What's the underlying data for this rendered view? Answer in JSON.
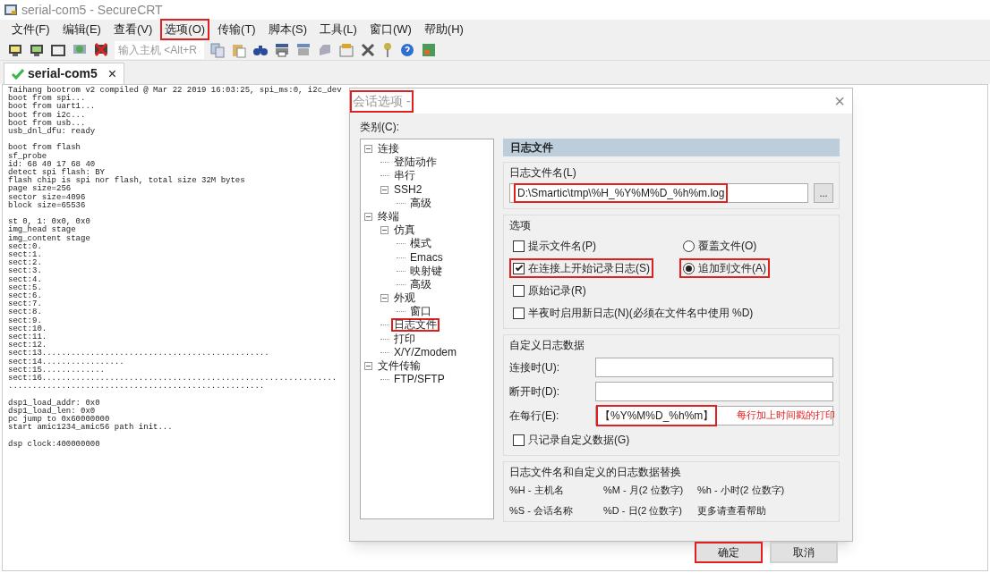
{
  "window": {
    "title": "serial-com5 - SecureCRT"
  },
  "menu": [
    {
      "label": "文件(F)",
      "highlighted": false
    },
    {
      "label": "编辑(E)",
      "highlighted": false
    },
    {
      "label": "查看(V)",
      "highlighted": false
    },
    {
      "label": "选项(O)",
      "highlighted": true
    },
    {
      "label": "传输(T)",
      "highlighted": false
    },
    {
      "label": "脚本(S)",
      "highlighted": false
    },
    {
      "label": "工具(L)",
      "highlighted": false
    },
    {
      "label": "窗口(W)",
      "highlighted": false
    },
    {
      "label": "帮助(H)",
      "highlighted": false
    }
  ],
  "toolbar": {
    "host_field": {
      "placeholder": "输入主机 <Alt+R"
    }
  },
  "tabs": [
    {
      "label": "serial-com5",
      "close": "×",
      "connected": true
    }
  ],
  "terminal": {
    "blocks": [
      [
        "Taihang bootrom v2 compiled @ Mar 22 2019 16:03:25, spi_ms:0, i2c_dev",
        "boot from spi...",
        "boot from uart1...",
        "boot from i2c...",
        "boot from usb...",
        "usb_dnl_dfu: ready"
      ],
      [
        "boot from flash",
        "sf_probe",
        "id: 68 40 17 68 40",
        "detect spi flash: BY",
        "flash chip is spi nor flash, total size 32M bytes",
        "page size=256",
        "sector size=4096",
        "block size=65536"
      ],
      [
        "st 0, 1: 0x0, 0x0",
        "img_head stage",
        "img_content stage",
        "sect:0.",
        "sect:1.",
        "sect:2.",
        "sect:3.",
        "sect:4.",
        "sect:5.",
        "sect:6.",
        "sect:7.",
        "sect:8.",
        "sect:9.",
        "sect:10.",
        "sect:11.",
        "sect:12.",
        "sect:13...............................................",
        "sect:14.................",
        "sect:15.............",
        "sect:16.............................................................",
        "....................................................."
      ],
      [
        "dsp1_load_addr: 0x0",
        "dsp1_load_len: 0x0",
        "pc jump to 0x60000000",
        "start amic1234_amic56 path init..."
      ],
      [
        "dsp clock:400000000"
      ]
    ]
  },
  "dialog": {
    "title": "会话选项 -",
    "title_highlighted": true,
    "close": "×",
    "category_label": "类别(C):",
    "tree": [
      {
        "label": "连接",
        "expanded": true,
        "highlighted": false,
        "children": [
          {
            "label": "登陆动作",
            "highlighted": false
          },
          {
            "label": "串行",
            "highlighted": false
          },
          {
            "label": "SSH2",
            "expanded": true,
            "highlighted": false,
            "children": [
              {
                "label": "高级",
                "highlighted": false
              }
            ]
          }
        ]
      },
      {
        "label": "终端",
        "expanded": true,
        "highlighted": false,
        "children": [
          {
            "label": "仿真",
            "expanded": true,
            "highlighted": false,
            "children": [
              {
                "label": "模式",
                "highlighted": false
              },
              {
                "label": "Emacs",
                "highlighted": false
              },
              {
                "label": "映射键",
                "highlighted": false
              },
              {
                "label": "高级",
                "highlighted": false
              }
            ]
          },
          {
            "label": "外观",
            "expanded": true,
            "highlighted": false,
            "children": [
              {
                "label": "窗口",
                "highlighted": false
              }
            ]
          },
          {
            "label": "日志文件",
            "highlighted": true
          },
          {
            "label": "打印",
            "highlighted": false
          },
          {
            "label": "X/Y/Zmodem",
            "highlighted": false
          }
        ]
      },
      {
        "label": "文件传输",
        "expanded": true,
        "highlighted": false,
        "children": [
          {
            "label": "FTP/SFTP",
            "highlighted": false
          }
        ]
      }
    ],
    "panel_title": "日志文件",
    "filename_group": {
      "title": "日志文件名(L)",
      "value": "D:\\Smartic\\tmp\\%H_%Y%M%D_%h%m.log",
      "highlighted": true,
      "browse": "..."
    },
    "options_group": {
      "title": "选项",
      "checkboxes": [
        {
          "label": "提示文件名(P)",
          "checked": false,
          "highlighted": false
        },
        {
          "label": "在连接上开始记录日志(S)",
          "checked": true,
          "highlighted": true
        },
        {
          "label": "原始记录(R)",
          "checked": false,
          "highlighted": false
        },
        {
          "label": "半夜时启用新日志(N)(必须在文件名中使用 %D)",
          "checked": false,
          "highlighted": false
        }
      ],
      "radios": [
        {
          "label": "覆盖文件(O)",
          "selected": false,
          "highlighted": false
        },
        {
          "label": "追加到文件(A)",
          "selected": true,
          "highlighted": true
        }
      ]
    },
    "custom_group": {
      "title": "自定义日志数据",
      "fields": [
        {
          "label": "连接时(U):"
        },
        {
          "label": "断开时(D):"
        },
        {
          "label": "在每行(E):",
          "value": "【%Y%M%D_%h%m】",
          "highlighted": true,
          "annotation": "每行加上时间戳的打印"
        }
      ],
      "checkbox": {
        "label": "只记录自定义数据(G)",
        "checked": false
      }
    },
    "subst_group": {
      "title": "日志文件名和自定义的日志数据替换",
      "items": [
        "%H - 主机名",
        "%M - 月(2 位数字)",
        "%h - 小时(2 位数字)",
        "%S - 会话名称",
        "%D - 日(2 位数字)",
        "更多请查看帮助"
      ]
    },
    "buttons": [
      {
        "label": "确定",
        "highlighted": true
      },
      {
        "label": "取消",
        "highlighted": false
      }
    ]
  }
}
